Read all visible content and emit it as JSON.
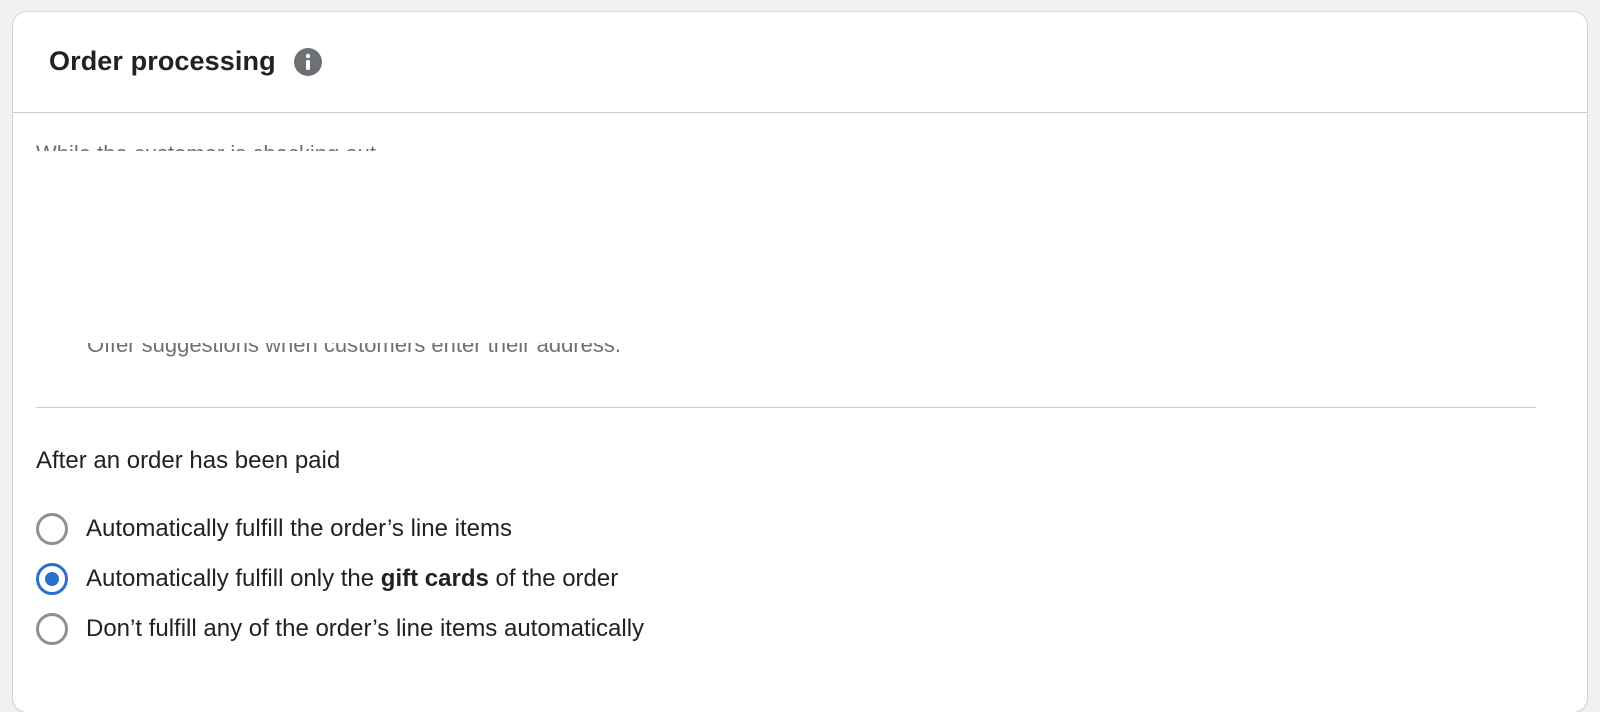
{
  "card": {
    "title": "Order processing",
    "info_icon": "info-icon"
  },
  "partial_text": {
    "top": "While the customer is checking out",
    "bottom": "Offer suggestions when customers enter their address."
  },
  "after_paid": {
    "label": "After an order has been paid",
    "options": [
      {
        "text": "Automatically fulfill the order’s line items",
        "checked": false
      },
      {
        "prefix": "Automatically fulfill only the ",
        "bold": "gift cards",
        "suffix": " of the order",
        "checked": true
      },
      {
        "text": "Don’t fulfill any of the order’s line items automatically",
        "checked": false
      }
    ]
  },
  "colors": {
    "accent": "#2c6ecb",
    "radio_border": "#8c9196",
    "divider": "#c9cccf"
  }
}
